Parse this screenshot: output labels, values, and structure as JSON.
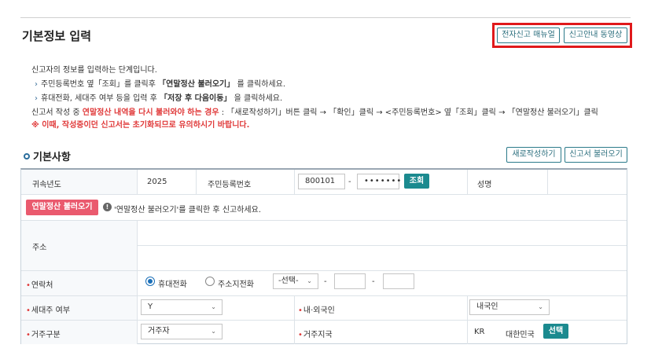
{
  "page": {
    "title": "기본정보 입력",
    "manual_button": "전자신고 매뉴얼",
    "video_button": "신고안내 동영상"
  },
  "guide": {
    "intro": "신고자의 정보를 입력하는 단계입니다.",
    "step1_pre": "주민등록번호 옆「조회」를 클릭후",
    "step1_bold": "「연말정산 불러오기」",
    "step1_post": "를 클릭하세요.",
    "step2_pre": "휴대전화, 세대주 여부 등을 입력 후",
    "step2_bold": "「저장 후 다음이동」",
    "step2_post": "을 클릭하세요.",
    "note_pre": "신고서 작성 중",
    "note_red": "연말정산 내역을 다시 불러와야 하는 경우",
    "note_post": ": 「새로작성하기」버튼 클릭 → 「확인」클릭 → <주민등록번호> 옆「조회」클릭 → 「연말정산 불러오기」클릭",
    "warning": "※ 이때, 작성중이던 신고서는 초기화되므로 유의하시기 바랍니다."
  },
  "section": {
    "title": "기본사항",
    "new_button": "새로작성하기",
    "load_button": "신고서 불러오기"
  },
  "form": {
    "year_label": "귀속년도",
    "year_value": "2025",
    "rrn_label": "주민등록번호",
    "rrn_front": "800101",
    "rrn_dash": "-",
    "rrn_back": "•••••••",
    "lookup_button": "조회",
    "name_label": "성명",
    "load_button": "연말정산 불러오기",
    "load_hint": "'연말정산 불러오기'를 클릭한 후 신고하세요.",
    "address_label": "주소",
    "contact_label": "연락처",
    "mobile_label": "휴대전화",
    "home_label": "주소지전화",
    "phone_select": "-선택-",
    "dash1": "-",
    "dash2": "-",
    "householder_label": "세대주 여부",
    "householder_value": "Y",
    "nationality_label": "내·외국인",
    "nationality_value": "내국인",
    "residence_label": "거주구분",
    "residence_value": "거주자",
    "country_label": "거주지국",
    "country_code": "KR",
    "country_name": "대한민국",
    "select_button": "선택"
  },
  "colors": {
    "highlight": "#e0191b",
    "teal": "#1b8a8f",
    "pink": "#ea5a6e",
    "required": "#e03a3a"
  },
  "icons": [
    "chevron-right-icon",
    "section-dot-icon",
    "info-icon",
    "chevron-down-icon",
    "radio-icon"
  ]
}
